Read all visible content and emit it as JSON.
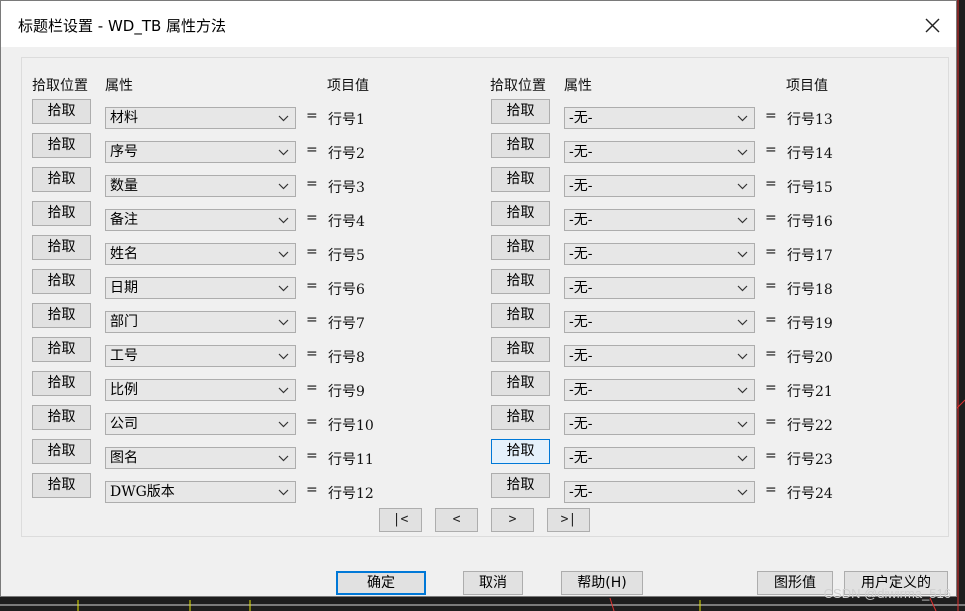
{
  "dialog": {
    "title": "标题栏设置 - WD_TB 属性方法"
  },
  "headers": {
    "left": {
      "pick": "拾取位置",
      "attr": "属性",
      "value": "项目值"
    },
    "right": {
      "pick": "拾取位置",
      "attr": "属性",
      "value": "项目值"
    }
  },
  "pick_label": "拾取",
  "equals": "=",
  "left_rows": [
    {
      "attr": "材料",
      "label": "行号1"
    },
    {
      "attr": "序号",
      "label": "行号2"
    },
    {
      "attr": "数量",
      "label": "行号3"
    },
    {
      "attr": "备注",
      "label": "行号4"
    },
    {
      "attr": "姓名",
      "label": "行号5"
    },
    {
      "attr": "日期",
      "label": "行号6"
    },
    {
      "attr": "部门",
      "label": "行号7"
    },
    {
      "attr": "工号",
      "label": "行号8"
    },
    {
      "attr": "比例",
      "label": "行号9"
    },
    {
      "attr": "公司",
      "label": "行号10"
    },
    {
      "attr": "图名",
      "label": "行号11"
    },
    {
      "attr": "DWG版本",
      "label": "行号12"
    }
  ],
  "right_rows": [
    {
      "attr": "-无-",
      "label": "行号13"
    },
    {
      "attr": "-无-",
      "label": "行号14"
    },
    {
      "attr": "-无-",
      "label": "行号15"
    },
    {
      "attr": "-无-",
      "label": "行号16"
    },
    {
      "attr": "-无-",
      "label": "行号17"
    },
    {
      "attr": "-无-",
      "label": "行号18"
    },
    {
      "attr": "-无-",
      "label": "行号19"
    },
    {
      "attr": "-无-",
      "label": "行号20"
    },
    {
      "attr": "-无-",
      "label": "行号21"
    },
    {
      "attr": "-无-",
      "label": "行号22"
    },
    {
      "attr": "-无-",
      "label": "行号23"
    },
    {
      "attr": "-无-",
      "label": "行号24"
    }
  ],
  "nav": {
    "first": "|<",
    "prev": "<",
    "next": ">",
    "last": ">|"
  },
  "footer": {
    "ok": "确定",
    "cancel": "取消",
    "help": "帮助(H)",
    "graphic_value": "图形值",
    "user_defined": "用户定义的"
  },
  "watermark": "CSDN @diwirma_516",
  "colors": {
    "accent": "#0078d7",
    "cad_background": "#1e1e1e"
  }
}
